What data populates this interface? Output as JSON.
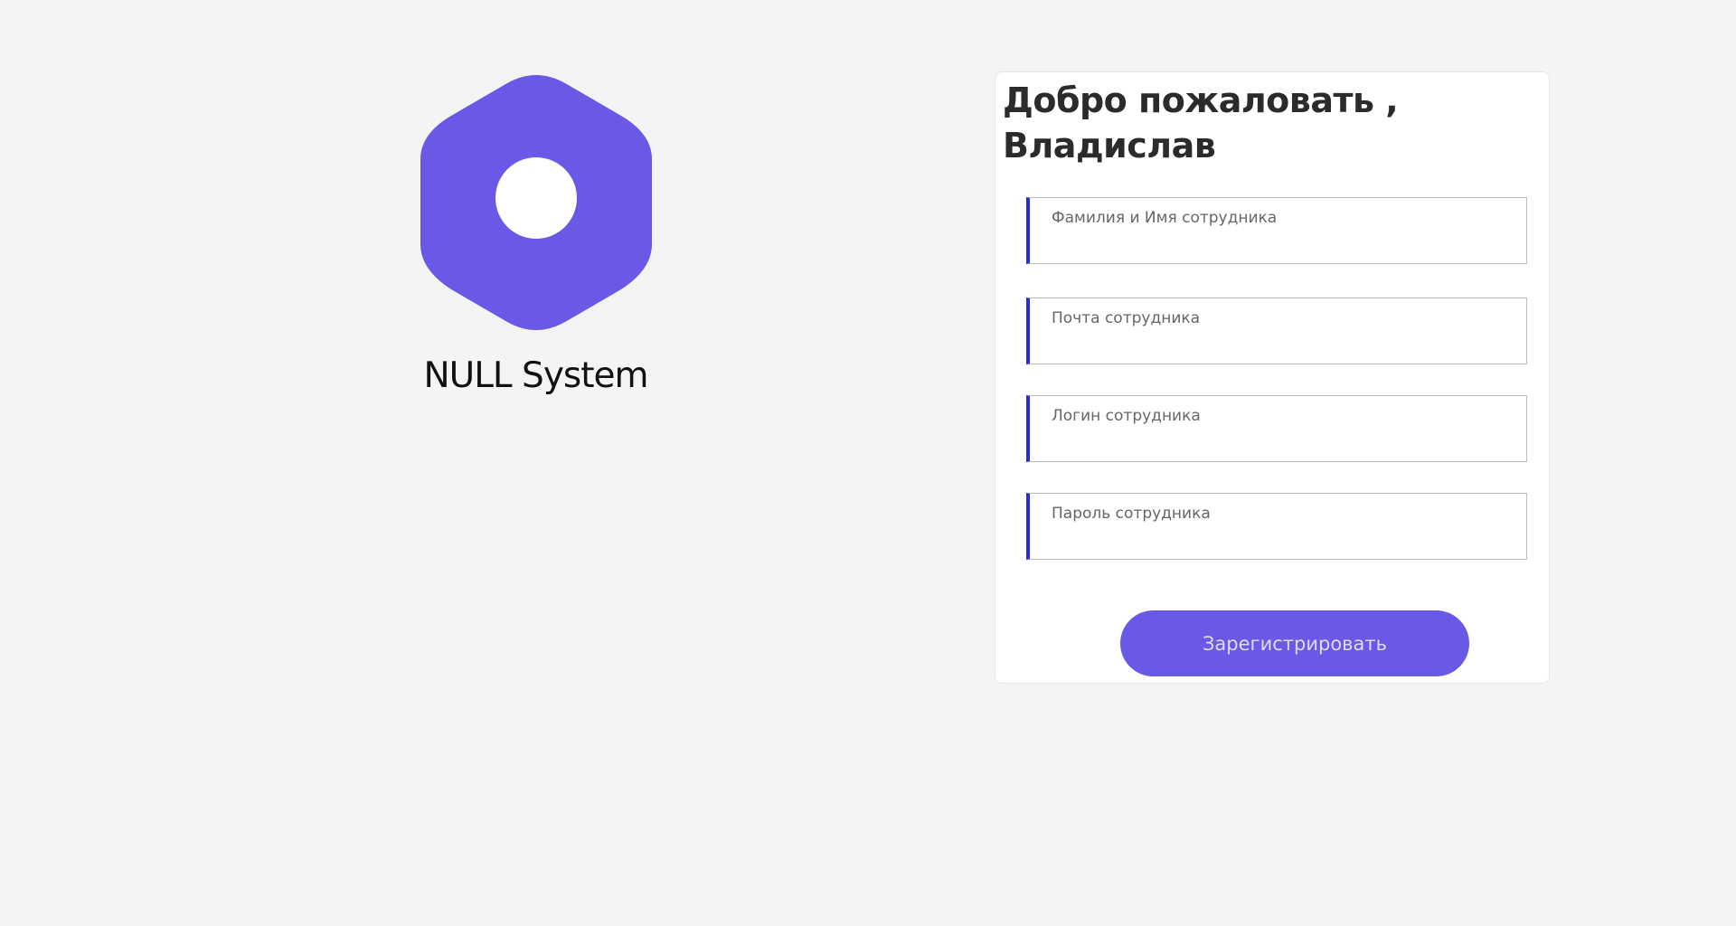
{
  "brand": {
    "name": "NULL System",
    "logo_icon": "hexagon-logo-icon",
    "logo_color": "#6a58e6"
  },
  "form": {
    "title_line1": "Добро пожаловать ,",
    "title_line2": "Владислав",
    "fields": [
      {
        "label": "Фамилия и Имя сотрудника",
        "value": ""
      },
      {
        "label": "Почта сотрудника",
        "value": ""
      },
      {
        "label": "Логин сотрудника",
        "value": ""
      },
      {
        "label": "Пароль сотрудника",
        "value": ""
      }
    ],
    "submit_label": "Зарегистрировать",
    "accent_color": "#2b2bd6",
    "button_color": "#6a58e6"
  }
}
